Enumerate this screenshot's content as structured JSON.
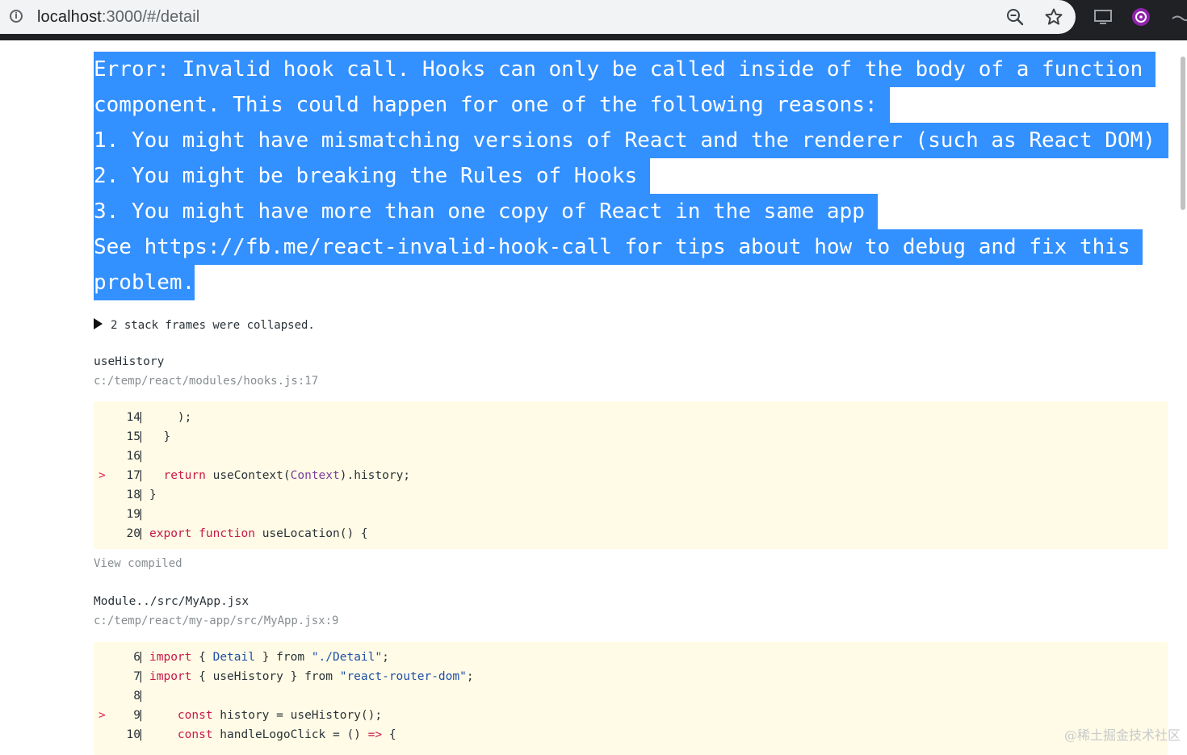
{
  "browser": {
    "url_host": "localhost",
    "url_rest": ":3000/#/detail",
    "icons": [
      "info-icon",
      "zoom-icon",
      "bookmark-star-icon",
      "cast-icon",
      "extension-icon",
      "profile-icon"
    ]
  },
  "overlay": {
    "close_label": "×",
    "error_lines": [
      "Error: Invalid hook call. Hooks can only be called inside of the body of a function ",
      "component. This could happen for one of the following reasons: ",
      "1. You might have mismatching versions of React and the renderer (such as React DOM) ",
      "2. You might be breaking the Rules of Hooks ",
      "3. You might have more than one copy of React in the same app ",
      "See https://fb.me/react-invalid-hook-call for tips about how to debug and fix this ",
      "problem."
    ],
    "collapsed_text": "2 stack frames were collapsed.",
    "frames": [
      {
        "name": "useHistory",
        "location": "c:/temp/react/modules/hooks.js:17",
        "lines": [
          {
            "num": "14",
            "highlight": false,
            "code": "    );"
          },
          {
            "num": "15",
            "highlight": false,
            "code": "  }"
          },
          {
            "num": "16",
            "highlight": false,
            "code": ""
          },
          {
            "num": "17",
            "highlight": true,
            "code": "  return useContext(Context).history;"
          },
          {
            "num": "18",
            "highlight": false,
            "code": "}"
          },
          {
            "num": "19",
            "highlight": false,
            "code": ""
          },
          {
            "num": "20",
            "highlight": false,
            "code": "export function useLocation() {"
          }
        ]
      },
      {
        "name": "Module../src/MyApp.jsx",
        "location": "c:/temp/react/my-app/src/MyApp.jsx:9",
        "lines": [
          {
            "num": "6",
            "highlight": false,
            "code": "import { Detail } from \"./Detail\";"
          },
          {
            "num": "7",
            "highlight": false,
            "code": "import { useHistory } from \"react-router-dom\";"
          },
          {
            "num": "8",
            "highlight": false,
            "code": ""
          },
          {
            "num": "9",
            "highlight": true,
            "code": "    const history = useHistory();"
          },
          {
            "num": "10",
            "highlight": false,
            "code": "    const handleLogoClick = () => {"
          }
        ]
      }
    ],
    "view_compiled": "View compiled",
    "arrow_glyph": ">",
    "gutter_bar": "|"
  },
  "watermark": "@稀土掘金技术社区",
  "colors": {
    "selection": "#3390ff",
    "code_bg": "#fffbe6",
    "keyword": "#c9184a",
    "muted": "#878e91"
  }
}
